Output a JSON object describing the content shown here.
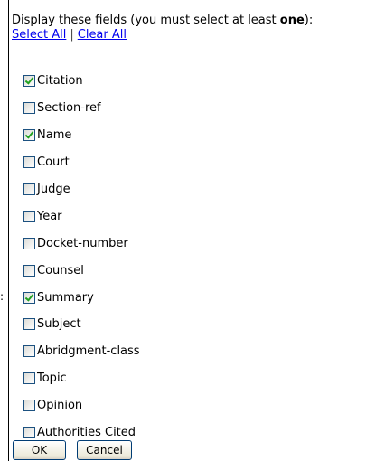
{
  "header": {
    "prefix": "Display these fields (you must select at least ",
    "emphasis": "one",
    "suffix": "):"
  },
  "links": {
    "select_all": "Select All",
    "separator": "|",
    "clear_all": "Clear All"
  },
  "fields": [
    {
      "label": "Citation",
      "checked": true
    },
    {
      "label": "Section-ref",
      "checked": false
    },
    {
      "label": "Name",
      "checked": true
    },
    {
      "label": "Court",
      "checked": false
    },
    {
      "label": "Judge",
      "checked": false
    },
    {
      "label": "Year",
      "checked": false
    },
    {
      "label": "Docket-number",
      "checked": false
    },
    {
      "label": "Counsel",
      "checked": false
    },
    {
      "label": "Summary",
      "checked": true
    },
    {
      "label": "Subject",
      "checked": false
    },
    {
      "label": "Abridgment-class",
      "checked": false
    },
    {
      "label": "Topic",
      "checked": false
    },
    {
      "label": "Opinion",
      "checked": false
    },
    {
      "label": "Authorities Cited",
      "checked": false
    }
  ],
  "buttons": {
    "ok": "OK",
    "cancel": "Cancel"
  },
  "left_mark": ":",
  "colors": {
    "link": "#0000ee",
    "checkmark": "#21a121",
    "checkbox_border": "#1c5180"
  }
}
